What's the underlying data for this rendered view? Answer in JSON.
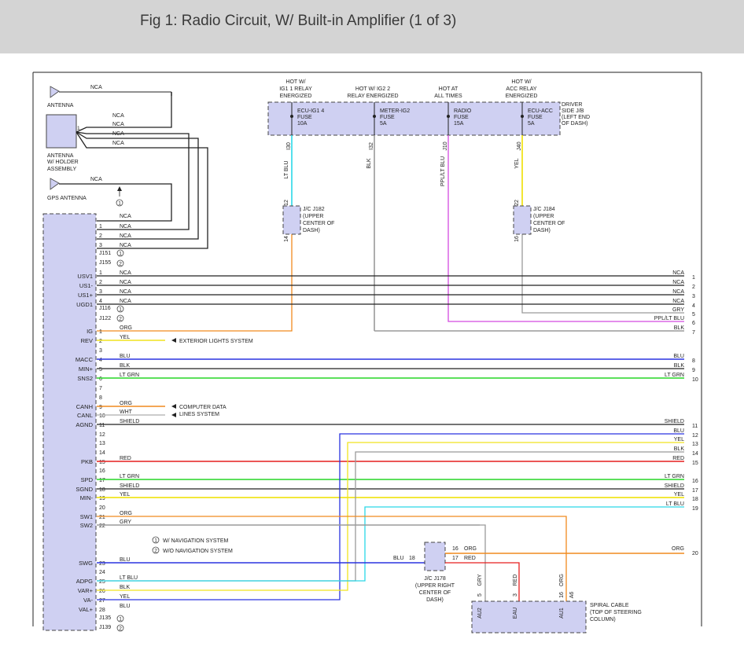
{
  "title": "Fig 1: Radio Circuit, W/ Built-in Amplifier (1 of 3)",
  "colors": {
    "blu": "#2a33e0",
    "ltblu": "#2ad8e8",
    "org": "#f08a1e",
    "yel": "#f0e41e",
    "red": "#e61e1e",
    "ltgrn": "#26d626",
    "ppl": "#d44ae0",
    "gry": "#9a9a9a",
    "blk": "#222222",
    "box": "#cfd0f2"
  },
  "fuse_headers": [
    "HOT W/",
    "IG1 1 RELAY",
    "ENERGIZED",
    "HOT W/ IG2 2",
    "RELAY ENERGIZED",
    "HOT AT",
    "ALL TIMES",
    "HOT W/",
    "ACC RELAY",
    "ENERGIZED"
  ],
  "fuses": [
    "ECU-IG1 4",
    "FUSE",
    "10A",
    "METER-IG2",
    "FUSE",
    "5A",
    "RADIO",
    "FUSE",
    "15A",
    "ECU-ACC",
    "FUSE",
    "5A"
  ],
  "jb_label": [
    "DRIVER",
    "SIDE J/B",
    "(LEFT END",
    "OF DASH)"
  ],
  "fuse_pins": [
    "I30",
    "I32",
    "J10",
    "J40"
  ],
  "vert_wire_labels": [
    "LT BLU",
    "BLK",
    "PPL/LT BLU",
    "YEL"
  ],
  "jc182": [
    "J/C J182",
    "(UPPER",
    "CENTER OF",
    "DASH)"
  ],
  "jc184": [
    "J/C J184",
    "(UPPER",
    "CENTER OF",
    "DASH)"
  ],
  "jc_pins": [
    "12",
    "14",
    "22",
    "16"
  ],
  "antenna": [
    "ANTENNA",
    "ANTENNA",
    "W/ HOLDER",
    "ASSEMBLY",
    "GPS ANTENNA"
  ],
  "antenna_nca": [
    "NCA",
    "NCA",
    "NCA",
    "NCA",
    "NCA",
    "NCA",
    "1"
  ],
  "top_block_nca": [
    "NCA",
    "NCA",
    "NCA",
    "NCA"
  ],
  "small_pins": [
    "1",
    "2",
    "3"
  ],
  "connectors": [
    "J151",
    "J155",
    "J116",
    "J122",
    "J135",
    "J139"
  ],
  "circle_marks": [
    "1",
    "2",
    "1",
    "2",
    "1",
    "2",
    "1"
  ],
  "legend": [
    "W/ NAVIGATION SYSTEM",
    "W/O NAVIGATION SYSTEM"
  ],
  "left_labels": [
    "USV1",
    "US1-",
    "US1+",
    "UGD1",
    "IG",
    "REV",
    "MACC",
    "MIN+",
    "SNS2",
    "CANH",
    "CANL",
    "AGND",
    "PKB",
    "SPD",
    "SGND",
    "MIN-",
    "SW1",
    "SW2",
    "SWG",
    "ADPG",
    "VAR+",
    "VA-",
    "VAL+"
  ],
  "rows": [
    {
      "p": "1",
      "c": "NCA",
      "r": "NCA",
      "n": "1"
    },
    {
      "p": "2",
      "c": "NCA",
      "r": "NCA",
      "n": "2"
    },
    {
      "p": "3",
      "c": "NCA",
      "r": "NCA",
      "n": "3"
    },
    {
      "p": "4",
      "c": "NCA",
      "r": "NCA",
      "n": "4"
    },
    {
      "p": "",
      "c": "",
      "r": "GRY",
      "n": "5"
    },
    {
      "p": "",
      "c": "",
      "r": "PPL/LT BLU",
      "n": "6"
    },
    {
      "p": "",
      "c": "",
      "r": "BLK",
      "n": "7"
    },
    {
      "p": "1",
      "c": "ORG",
      "r": "",
      "n": ""
    },
    {
      "p": "2",
      "c": "YEL",
      "r": "",
      "n": ""
    },
    {
      "p": "3",
      "c": "",
      "r": "",
      "n": ""
    },
    {
      "p": "4",
      "c": "BLU",
      "r": "BLU",
      "n": "8"
    },
    {
      "p": "5",
      "c": "BLK",
      "r": "BLK",
      "n": "9"
    },
    {
      "p": "6",
      "c": "LT GRN",
      "r": "LT GRN",
      "n": "10"
    },
    {
      "p": "7",
      "c": "",
      "r": "",
      "n": ""
    },
    {
      "p": "8",
      "c": "",
      "r": "",
      "n": ""
    },
    {
      "p": "9",
      "c": "ORG",
      "r": "",
      "n": ""
    },
    {
      "p": "10",
      "c": "WHT",
      "r": "",
      "n": ""
    },
    {
      "p": "11",
      "c": "SHIELD",
      "r": "SHIELD",
      "n": "11"
    },
    {
      "p": "12",
      "c": "",
      "r": "BLU",
      "n": "12"
    },
    {
      "p": "13",
      "c": "",
      "r": "YEL",
      "n": "13"
    },
    {
      "p": "14",
      "c": "",
      "r": "BLK",
      "n": "14"
    },
    {
      "p": "15",
      "c": "RED",
      "r": "RED",
      "n": "15"
    },
    {
      "p": "16",
      "c": "",
      "r": "",
      "n": ""
    },
    {
      "p": "17",
      "c": "LT GRN",
      "r": "LT GRN",
      "n": "16"
    },
    {
      "p": "18",
      "c": "SHIELD",
      "r": "SHIELD",
      "n": "17"
    },
    {
      "p": "19",
      "c": "YEL",
      "r": "YEL",
      "n": "18"
    },
    {
      "p": "20",
      "c": "",
      "r": "LT BLU",
      "n": "19"
    },
    {
      "p": "21",
      "c": "ORG",
      "r": "",
      "n": ""
    },
    {
      "p": "22",
      "c": "GRY",
      "r": "",
      "n": ""
    },
    {
      "p": "23",
      "c": "BLU",
      "r": "",
      "n": ""
    },
    {
      "p": "24",
      "c": "",
      "r": "",
      "n": ""
    },
    {
      "p": "25",
      "c": "LT BLU",
      "r": "",
      "n": ""
    },
    {
      "p": "26",
      "c": "BLK",
      "r": "",
      "n": ""
    },
    {
      "p": "27",
      "c": "YEL",
      "r": "",
      "n": ""
    },
    {
      "p": "28",
      "c": "BLU",
      "r": "",
      "n": ""
    }
  ],
  "arrows": [
    "EXTERIOR LIGHTS SYSTEM",
    "COMPUTER DATA",
    "LINES SYSTEM"
  ],
  "jc178": [
    "J/C J178",
    "(UPPER RIGHT",
    "CENTER OF",
    "DASH)"
  ],
  "jc178_pins": [
    "BLU",
    "18",
    "16",
    "ORG",
    "17",
    "RED"
  ],
  "org20": [
    "ORG",
    "20"
  ],
  "spiral": [
    "SPIRAL CABLE",
    "(TOP OF STEERING",
    "COLUMN)"
  ],
  "spiral_pins": [
    "AU2",
    "EAU",
    "AU1",
    "5",
    "3",
    "16",
    "A6"
  ],
  "spiral_wires": [
    "GRY",
    "RED",
    "ORG"
  ]
}
